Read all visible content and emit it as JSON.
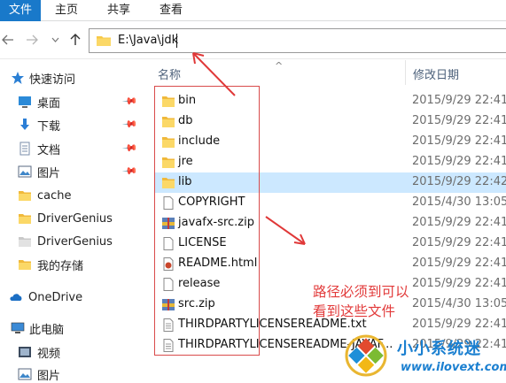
{
  "ribbon": {
    "tabs": [
      "文件",
      "主页",
      "共享",
      "查看"
    ]
  },
  "address": {
    "path": "E:\\Java\\jdk"
  },
  "sidebar": {
    "items": [
      {
        "label": "快速访问",
        "icon": "star-icon",
        "pinned": false
      },
      {
        "label": "桌面",
        "icon": "desktop-icon",
        "pinned": true
      },
      {
        "label": "下载",
        "icon": "download-icon",
        "pinned": true
      },
      {
        "label": "文档",
        "icon": "document-icon",
        "pinned": true
      },
      {
        "label": "图片",
        "icon": "pictures-icon",
        "pinned": true
      },
      {
        "label": "cache",
        "icon": "folder-icon",
        "pinned": false
      },
      {
        "label": "DriverGenius",
        "icon": "folder-icon",
        "pinned": false
      },
      {
        "label": "DriverGenius",
        "icon": "folder-icon",
        "pinned": false
      },
      {
        "label": "我的存储",
        "icon": "folder-icon",
        "pinned": false
      },
      {
        "label": "OneDrive",
        "icon": "cloud-icon",
        "pinned": false
      },
      {
        "label": "此电脑",
        "icon": "computer-icon",
        "pinned": false
      },
      {
        "label": "视频",
        "icon": "video-icon",
        "pinned": false
      },
      {
        "label": "图片",
        "icon": "pictures-icon",
        "pinned": false
      }
    ]
  },
  "columns": {
    "name": "名称",
    "date": "修改日期"
  },
  "files": [
    {
      "name": "bin",
      "date": "2015/9/29 22:41",
      "type": "folder"
    },
    {
      "name": "db",
      "date": "2015/9/29 22:41",
      "type": "folder"
    },
    {
      "name": "include",
      "date": "2015/9/29 22:41",
      "type": "folder"
    },
    {
      "name": "jre",
      "date": "2015/9/29 22:41",
      "type": "folder"
    },
    {
      "name": "lib",
      "date": "2015/9/29 22:42",
      "type": "folder",
      "selected": true
    },
    {
      "name": "COPYRIGHT",
      "date": "2015/4/30 13:05",
      "type": "file"
    },
    {
      "name": "javafx-src.zip",
      "date": "2015/9/29 22:41",
      "type": "zip"
    },
    {
      "name": "LICENSE",
      "date": "2015/9/29 22:41",
      "type": "file"
    },
    {
      "name": "README.html",
      "date": "2015/9/29 22:41",
      "type": "html"
    },
    {
      "name": "release",
      "date": "2015/9/29 22:41",
      "type": "file"
    },
    {
      "name": "src.zip",
      "date": "2015/4/30 13:05",
      "type": "zip"
    },
    {
      "name": "THIRDPARTYLICENSEREADME.txt",
      "date": "2015/9/29 22:41",
      "type": "txt"
    },
    {
      "name": "THIRDPARTYLICENSEREADME-JAVAF...",
      "date": "2015/9/29 22:41",
      "type": "txt"
    }
  ],
  "annotation": {
    "line1": "路径必须到可以",
    "line2": "看到这些文件",
    "color": "#e23a3a"
  },
  "watermark": {
    "title": "小小系统迷",
    "url": "www.ilovext.com"
  },
  "colors": {
    "accent": "#1979ca",
    "selection": "#cce8ff",
    "folder": "#f7c948"
  }
}
